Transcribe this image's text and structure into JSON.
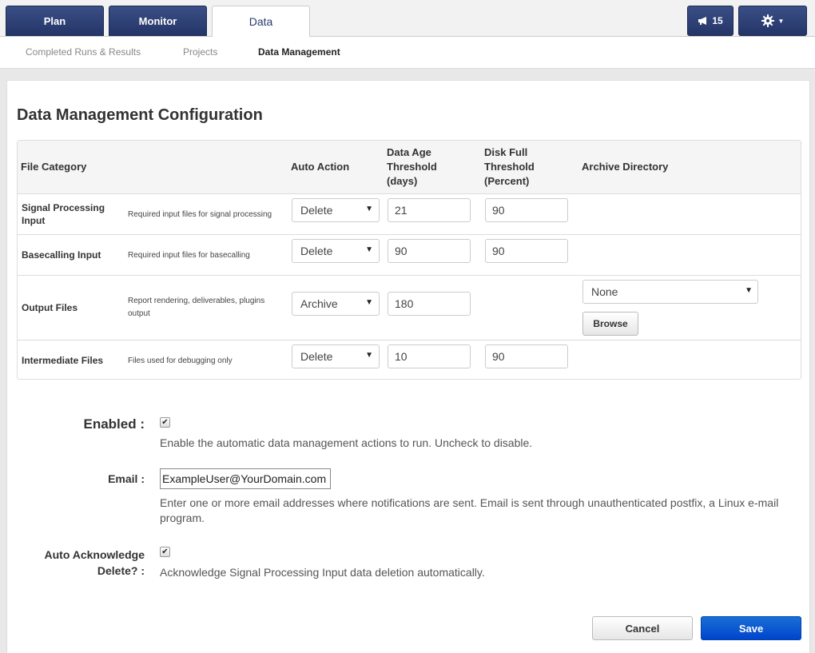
{
  "tabs": [
    {
      "label": "Plan"
    },
    {
      "label": "Monitor"
    },
    {
      "label": "Data"
    }
  ],
  "notifications": {
    "count": "15",
    "icon": "megaphone-icon"
  },
  "settings": {
    "icon": "gear-icon"
  },
  "subnav": [
    {
      "label": "Completed Runs & Results"
    },
    {
      "label": "Projects"
    },
    {
      "label": "Data Management"
    }
  ],
  "page": {
    "title": "Data Management Configuration"
  },
  "table": {
    "headers": {
      "category": "File Category",
      "action": "Auto Action",
      "age_l1": "Data Age",
      "age_l2": "Threshold",
      "age_l3": "(days)",
      "disk_l1": "Disk Full",
      "disk_l2": "Threshold",
      "disk_l3": "(Percent)",
      "archive": "Archive Directory"
    },
    "rows": [
      {
        "name_l1": "Signal Processing",
        "name_l2": "Input",
        "desc": "Required input files for signal processing",
        "action": "Delete",
        "age": "21",
        "disk": "90"
      },
      {
        "name": "Basecalling Input",
        "desc": "Required input files for basecalling",
        "action": "Delete",
        "age": "90",
        "disk": "90"
      },
      {
        "name": "Output Files",
        "desc": "Report rendering, deliverables, plugins output",
        "action": "Archive",
        "age": "180",
        "archive": "None",
        "browse": "Browse"
      },
      {
        "name": "Intermediate Files",
        "desc": "Files used for debugging only",
        "action": "Delete",
        "age": "10",
        "disk": "90"
      }
    ]
  },
  "form": {
    "enabled_label": "Enabled :",
    "enabled_checked": true,
    "enabled_help": "Enable the automatic data management actions to run. Uncheck to disable.",
    "email_label": "Email :",
    "email_value": "ExampleUser@YourDomain.com",
    "email_help_l1": "Enter one or more email addresses where notifications are sent. Email is sent through unauthenticated postfix, a Linux e-mail",
    "email_help_l2": "program.",
    "ack_label_l1": "Auto Acknowledge",
    "ack_label_l2": "Delete? :",
    "ack_checked": true,
    "ack_help": "Acknowledge Signal Processing Input data deletion automatically."
  },
  "buttons": {
    "cancel": "Cancel",
    "save": "Save"
  }
}
